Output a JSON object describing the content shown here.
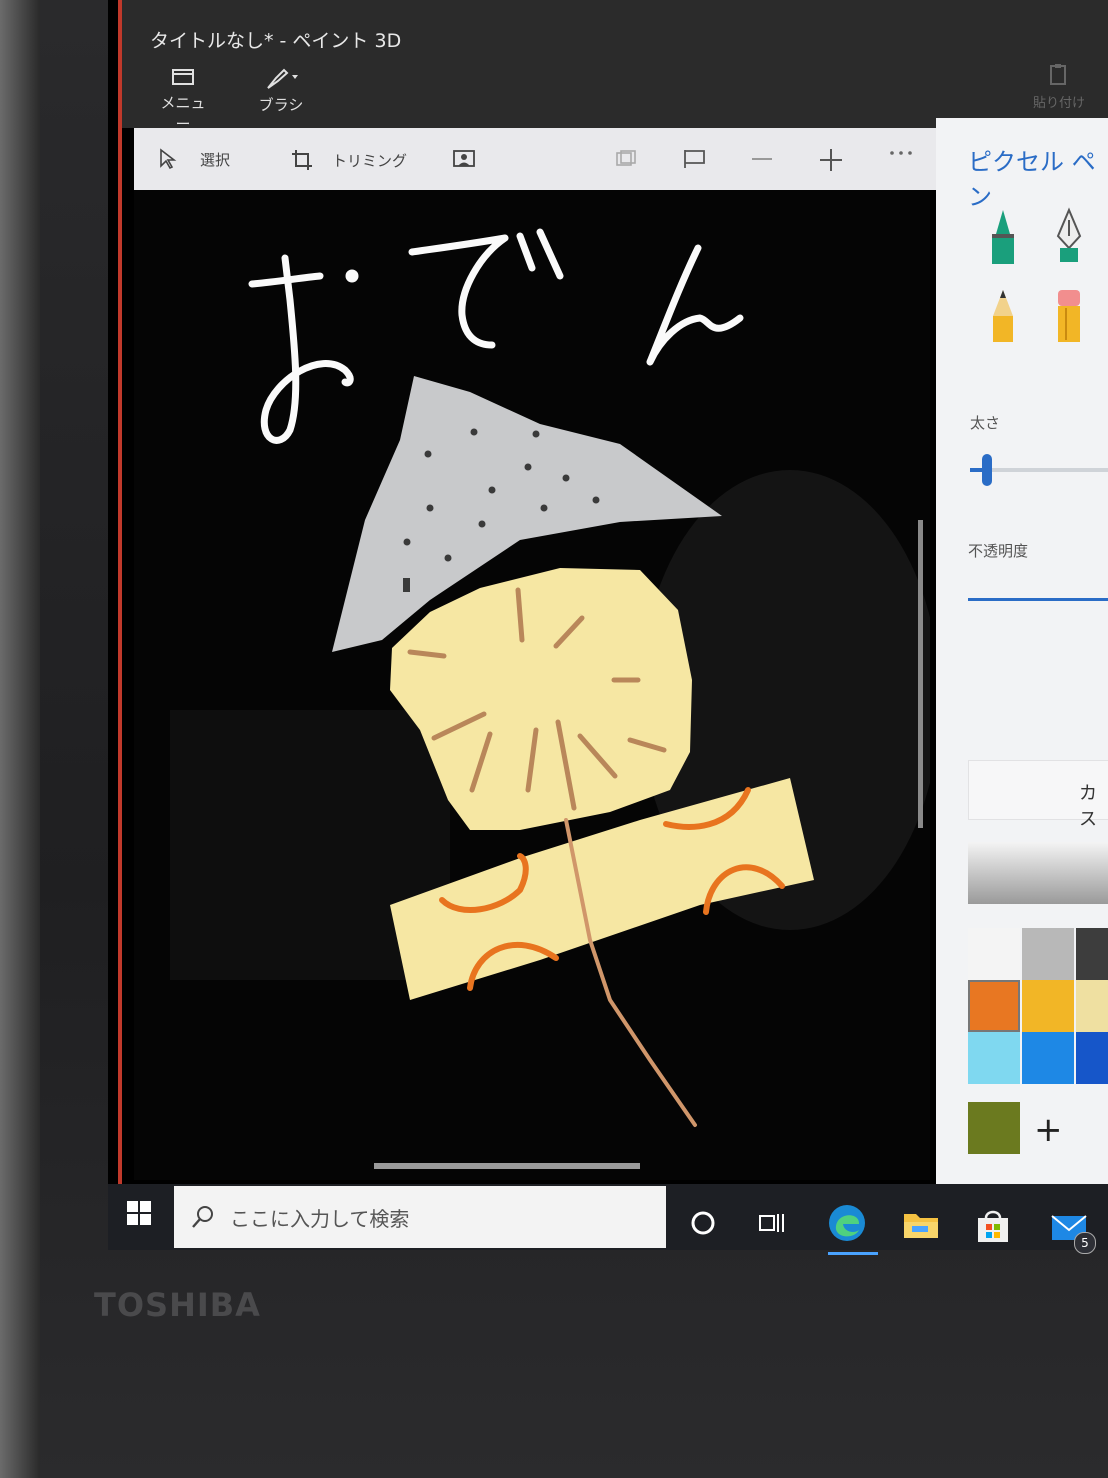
{
  "window": {
    "title": "タイトルなし* - ペイント 3D"
  },
  "ribbon": {
    "menu_label": "メニュー",
    "brush_label": "ブラシ",
    "paste_label": "貼り付け"
  },
  "toolbar": {
    "select_label": "選択",
    "crop_label": "トリミング"
  },
  "canvas": {
    "drawn_text": "おでん"
  },
  "panel": {
    "title": "ピクセル ペン",
    "thickness_label": "太さ",
    "opacity_label": "不透明度",
    "custom_label": "カス",
    "add_color": "+",
    "swatches": [
      "#f4f4f4",
      "#b8b8b8",
      "#3d3d3d",
      "#e87722",
      "#f2b626",
      "#efe0a1",
      "#7fd8f0",
      "#1e88e5",
      "#1656c9",
      "#6b7a1f"
    ]
  },
  "taskbar": {
    "search_placeholder": "ここに入力して検索",
    "mail_badge": "5"
  },
  "device": {
    "brand": "TOSHIBA"
  }
}
